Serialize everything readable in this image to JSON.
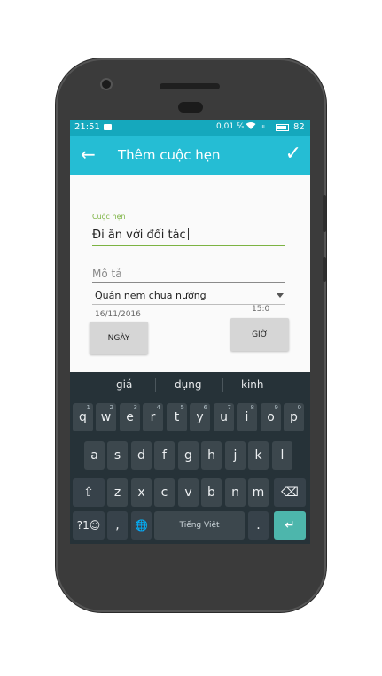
{
  "status": {
    "time": "21:51",
    "network_speed": "0,01 ᴷ⁄ₛ",
    "signal": "ᵢₗₗ",
    "battery_level": "82"
  },
  "toolbar": {
    "title": "Thêm cuộc hẹn"
  },
  "form": {
    "appointment_label": "Cuộc hẹn",
    "appointment_value": "Đi ăn với đối tác",
    "description_placeholder": "Mô tả",
    "place_value": "Quán nem chua nướng",
    "date_value": "16/11/2016",
    "time_value": "15:0",
    "date_button": "NGÀY",
    "time_button": "GIỜ"
  },
  "keyboard": {
    "suggestions": [
      "giá",
      "dụng",
      "kinh"
    ],
    "row1": [
      {
        "k": "q",
        "h": "1"
      },
      {
        "k": "w",
        "h": "2"
      },
      {
        "k": "e",
        "h": "3"
      },
      {
        "k": "r",
        "h": "4"
      },
      {
        "k": "t",
        "h": "5"
      },
      {
        "k": "y",
        "h": "6"
      },
      {
        "k": "u",
        "h": "7"
      },
      {
        "k": "i",
        "h": "8"
      },
      {
        "k": "o",
        "h": "9"
      },
      {
        "k": "p",
        "h": "0"
      }
    ],
    "row2": [
      "a",
      "s",
      "d",
      "f",
      "g",
      "h",
      "j",
      "k",
      "l"
    ],
    "row3": [
      "z",
      "x",
      "c",
      "v",
      "b",
      "n",
      "m"
    ],
    "symbols_label": "?1☺",
    "comma": ",",
    "period": ".",
    "space_label": "Tiếng Việt",
    "shift_icon": "⇧",
    "backspace_icon": "⌫",
    "globe_icon": "🌐",
    "enter_icon": "↵"
  },
  "colors": {
    "statusbar": "#15a8bd",
    "toolbar": "#25bdd4",
    "accent_green": "#7cb342",
    "keyboard_bg": "#263238",
    "enter_key": "#4db6ac"
  }
}
